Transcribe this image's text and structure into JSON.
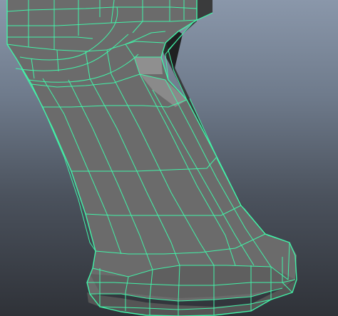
{
  "viewport": {
    "title": "",
    "background_top": "#8a97aa",
    "background_bottom": "#2f3238"
  },
  "model": {
    "name": "",
    "shading": "wireframe-on-shaded",
    "surface_color": "#6b6b6b",
    "side_color": "#3a3b3c",
    "highlight_color": "#9a9a9a",
    "wire_color": "#42f3a8"
  }
}
